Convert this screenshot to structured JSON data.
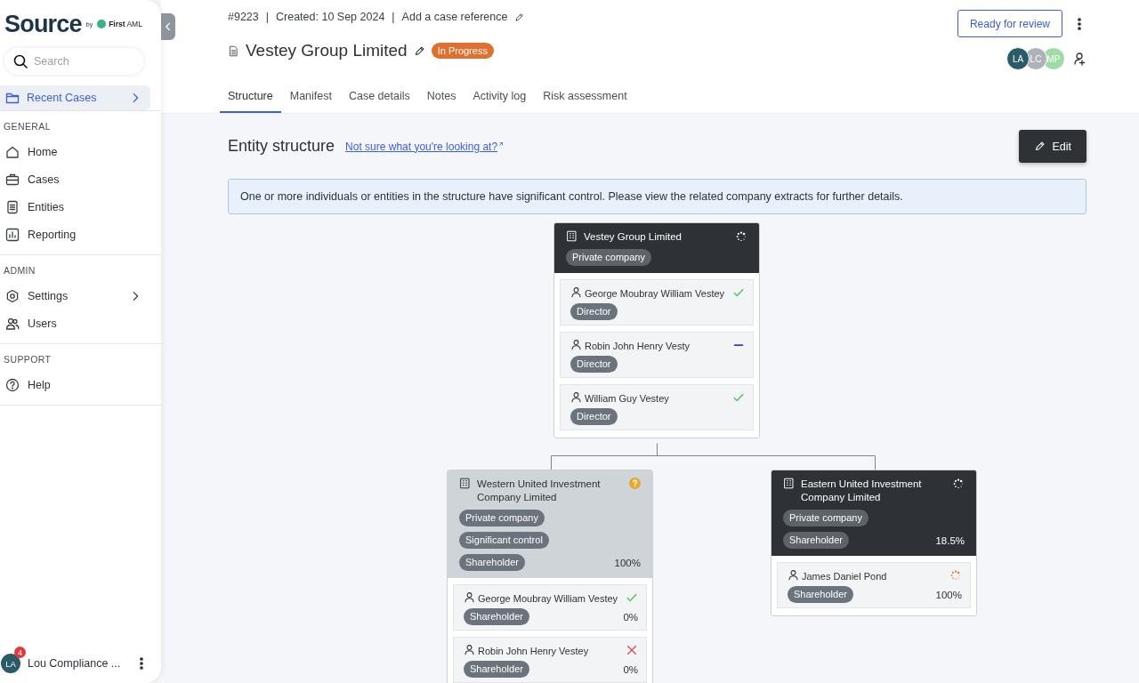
{
  "sidebar": {
    "brand": "Source",
    "by": "by",
    "partner": "**First** AML",
    "search": {
      "placeholder": "Search"
    },
    "pinned": {
      "label": "Recent Cases",
      "selected": true
    },
    "sections": [
      {
        "title": "GENERAL",
        "items": [
          {
            "label": "Home",
            "selected": false,
            "chevron": false
          },
          {
            "label": "Cases",
            "selected": false,
            "chevron": false
          },
          {
            "label": "Entities",
            "selected": false,
            "chevron": false
          },
          {
            "label": "Reporting",
            "selected": false,
            "chevron": false
          }
        ]
      },
      {
        "title": "ADMIN",
        "items": [
          {
            "label": "Settings",
            "selected": false,
            "chevron": true
          },
          {
            "label": "Users",
            "selected": false,
            "chevron": false
          }
        ]
      },
      {
        "title": "SUPPORT",
        "items": [
          {
            "label": "Help",
            "selected": false,
            "chevron": false
          }
        ]
      }
    ],
    "user": {
      "initials": "LA",
      "badge": "4",
      "name": "Lou Compliance ..."
    }
  },
  "header": {
    "case_number": "#9223",
    "separators": [
      "|",
      "|"
    ],
    "created": "Created: 10 Sep 2024",
    "reference_link": "Add a case reference",
    "title": "Vestey Group Limited",
    "status": "In Progress",
    "review_button": "Ready for review",
    "assignees": [
      {
        "initials": "LA",
        "color": "#2b5a68"
      },
      {
        "initials": "LC",
        "color": "#aeb3b9"
      },
      {
        "initials": "MP",
        "color": "#9fdba6"
      }
    ]
  },
  "tabs": [
    {
      "label": "Structure",
      "selected": true
    },
    {
      "label": "Manifest",
      "selected": false
    },
    {
      "label": "Case details",
      "selected": false
    },
    {
      "label": "Notes",
      "selected": false
    },
    {
      "label": "Activity log",
      "selected": false
    },
    {
      "label": "Risk assessment",
      "selected": false
    }
  ],
  "structure": {
    "heading": "Entity structure",
    "help_link": "Not sure what you're looking at?",
    "edit_button": "Edit",
    "notice": "One or more individuals or entities in the structure have significant control. Please view the related company extracts for further details.",
    "root": {
      "name": "Vestey Group Limited",
      "kind": "pending",
      "selected": false,
      "tags": [
        "Private company"
      ],
      "people": [
        {
          "name": "George Moubray William Vestey",
          "kind": "check",
          "tag": "Director"
        },
        {
          "name": "Robin John Henry Vesty",
          "kind": "dash",
          "tag": "Director"
        },
        {
          "name": "William Guy Vestey",
          "kind": "check",
          "tag": "Director"
        }
      ],
      "children": [
        {
          "name": "Western United Investment Company Limited",
          "kind": "question",
          "selected": true,
          "tags": [
            "Private company",
            "Significant control",
            "Shareholder"
          ],
          "share": "100%",
          "people": [
            {
              "name": "George Moubray William Vestey",
              "kind": "check",
              "tag": "Shareholder",
              "share": "0%"
            },
            {
              "name": "Robin John Henry Vestey",
              "kind": "cross",
              "tag": "Shareholder",
              "share": "0%"
            }
          ]
        },
        {
          "name": "Eastern United Investment Company Limited",
          "kind": "pending",
          "selected": false,
          "tags": [
            "Private company",
            "Shareholder"
          ],
          "share": "18.5%",
          "people": [
            {
              "name": "James Daniel Pond",
              "kind": "pending",
              "tag": "Shareholder",
              "share": "100%"
            }
          ]
        }
      ]
    }
  }
}
